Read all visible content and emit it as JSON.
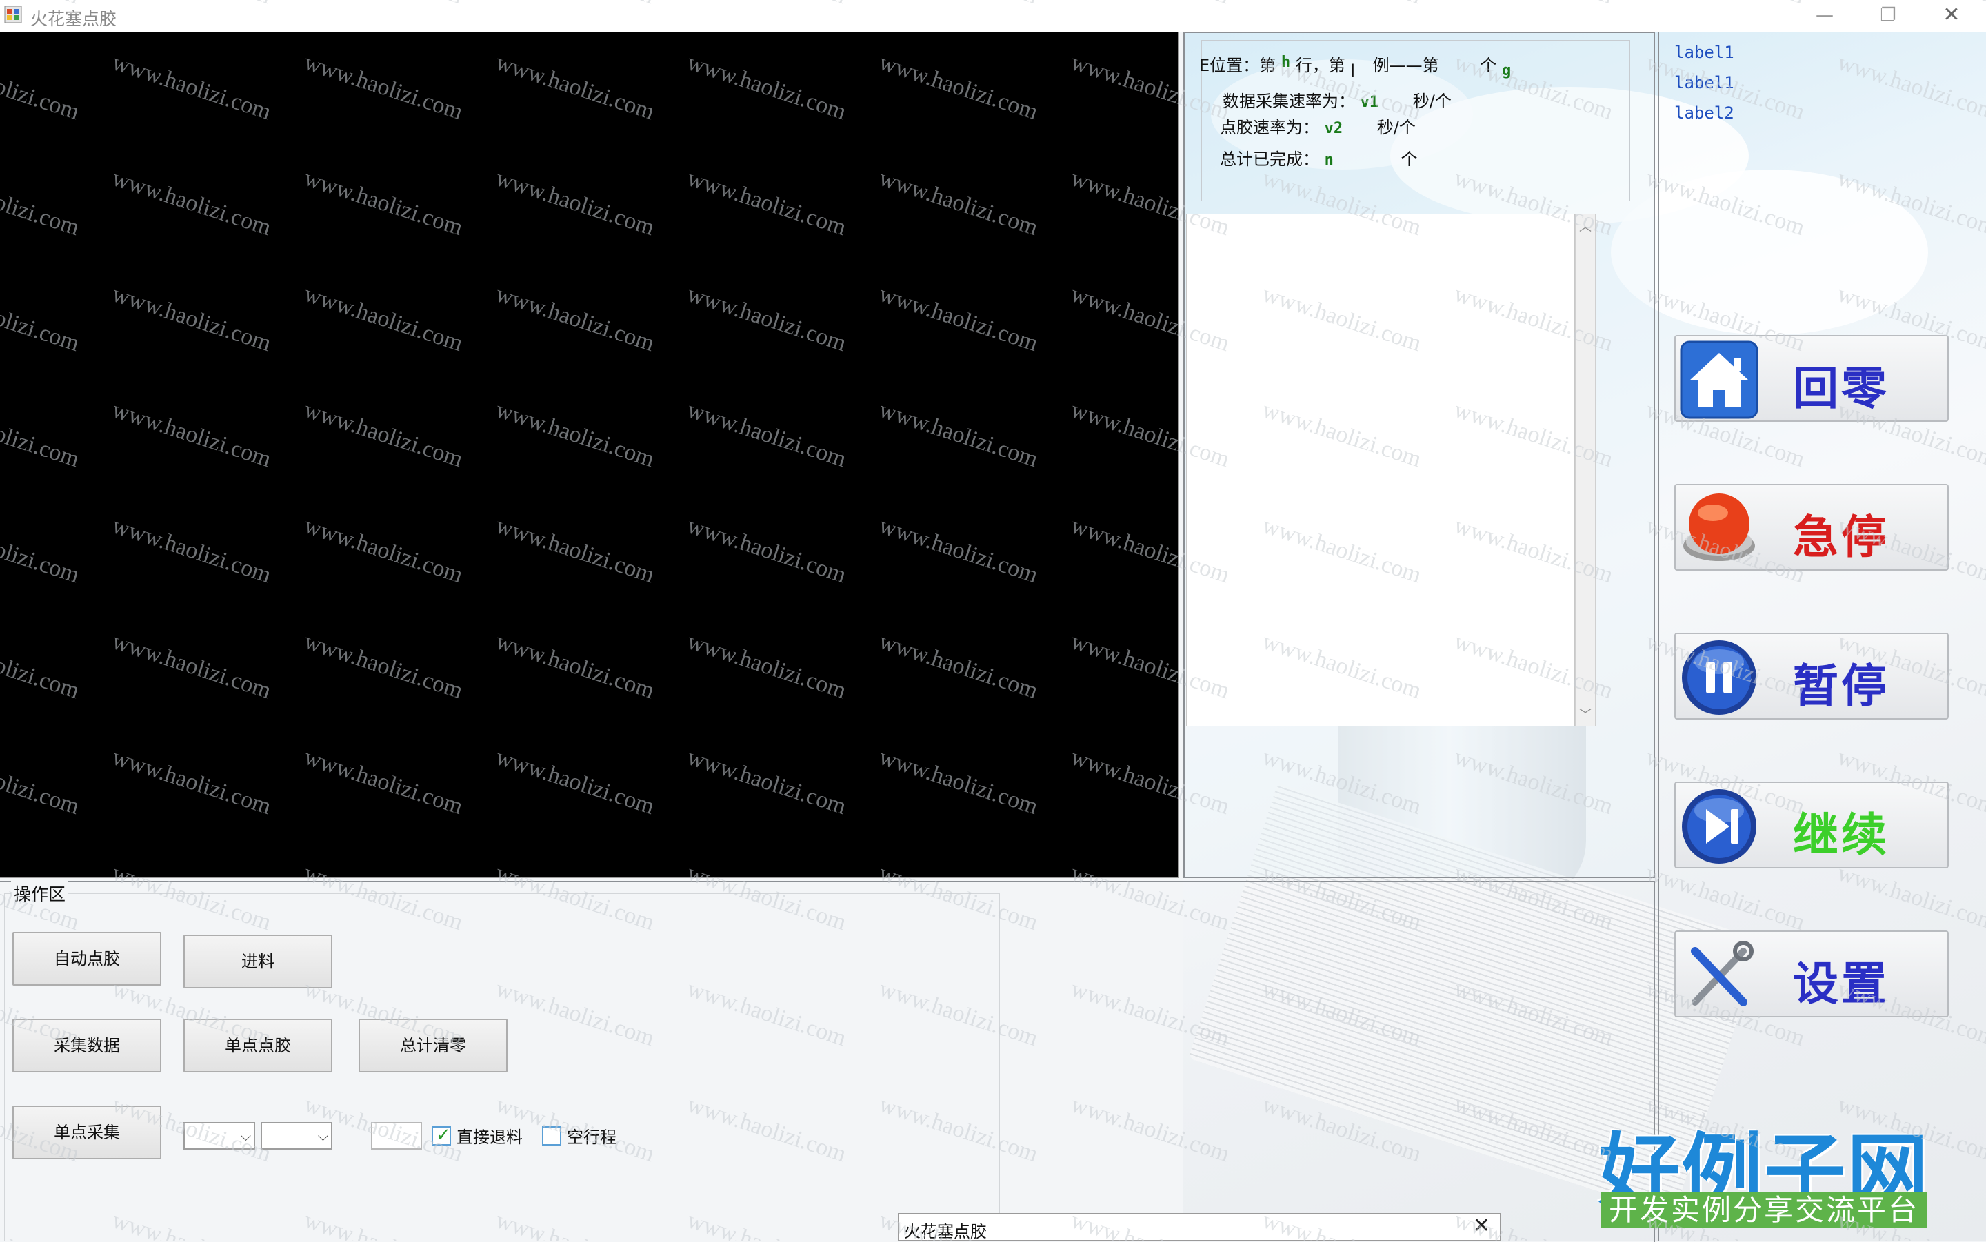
{
  "window": {
    "title": "火花塞点胶",
    "min": "—",
    "max": "❐",
    "close": "✕"
  },
  "info": {
    "position_prefix": "E位置：第",
    "row_var": "h",
    "row_suffix": "行，第",
    "col_var": "l",
    "col_suffix": "例——第",
    "count_suffix": "个",
    "item_var": "g",
    "collect_rate_label": "数据采集速率为：",
    "collect_rate_var": "v1",
    "collect_rate_unit": "秒/个",
    "dispense_rate_label": "点胶速率为：",
    "dispense_rate_var": "v2",
    "dispense_rate_unit": "秒/个",
    "total_label": "总计已完成：",
    "total_var": "n",
    "total_unit": "个"
  },
  "labels": [
    "label1",
    "label1",
    "label2"
  ],
  "controls": {
    "home": "回零",
    "estop": "急停",
    "pause": "暂停",
    "resume": "继续",
    "settings": "设置"
  },
  "ops": {
    "legend": "操作区",
    "auto_dispense": "自动点胶",
    "feed": "进料",
    "collect_data": "采集数据",
    "single_dispense": "单点点胶",
    "reset_total": "总计清零",
    "single_collect": "单点采集",
    "direct_unload": "直接退料",
    "direct_unload_checked": true,
    "idle_run": "空行程",
    "idle_run_checked": false
  },
  "logo": {
    "main": "好例子网",
    "sub": "开发实例分享交流平台"
  },
  "watermark": "www.haolizi.com",
  "popup": {
    "title": "火花塞点胶",
    "close": "✕"
  },
  "colors": {
    "home_text": "#2a2fc4",
    "estop_text": "#d81e1e",
    "pause_text": "#2a2fc4",
    "resume_text": "#3ccf2a",
    "settings_text": "#2a2fc4"
  }
}
